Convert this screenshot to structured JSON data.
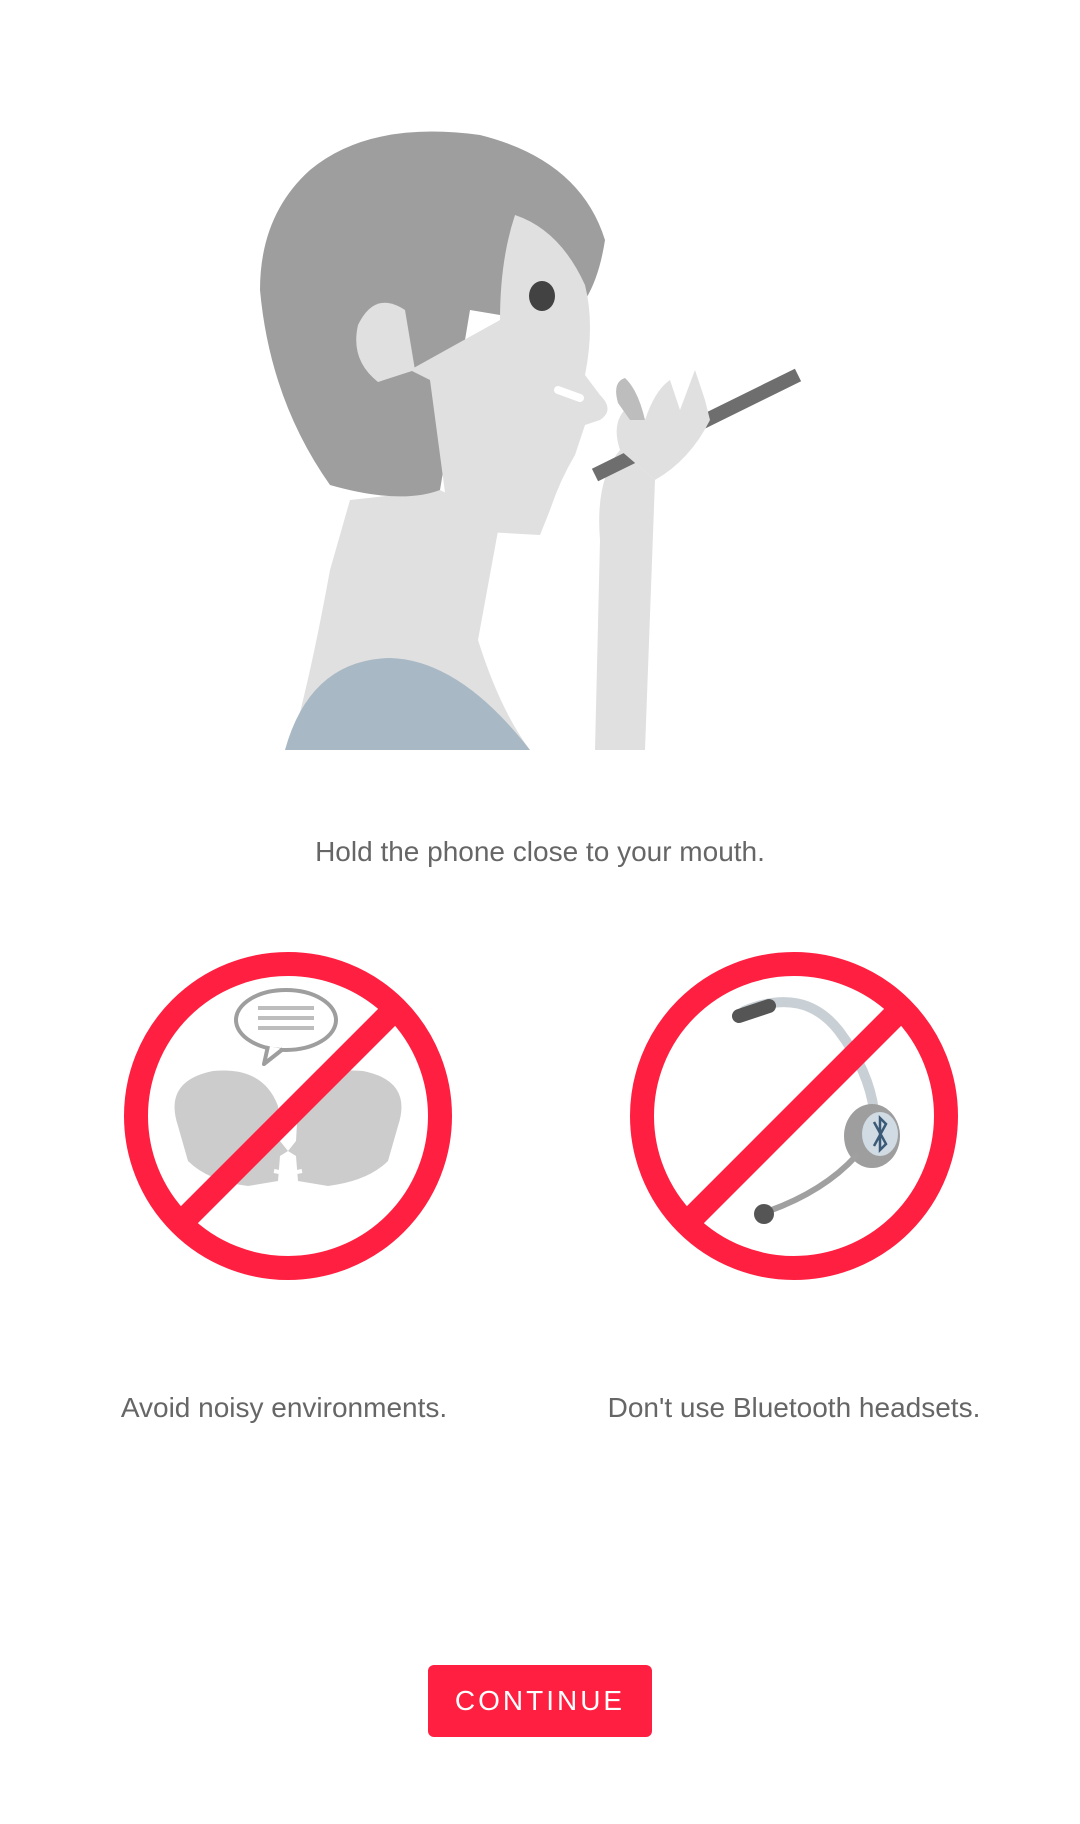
{
  "main": {
    "illustration_icon": "woman-holding-phone-to-mouth",
    "caption": "Hold the phone close to your mouth."
  },
  "tips": [
    {
      "icon": "no-noisy-environment-icon",
      "caption": "Avoid noisy environments."
    },
    {
      "icon": "no-bluetooth-headset-icon",
      "caption": "Don't use Bluetooth headsets."
    }
  ],
  "continue_button": {
    "label": "CONTINUE"
  },
  "colors": {
    "accent": "#ff1f40",
    "text": "#666666",
    "hair": "#9e9e9e",
    "skin": "#e0e0e0",
    "shirt": "#a8b8c4",
    "phone": "#6e6e6e"
  }
}
